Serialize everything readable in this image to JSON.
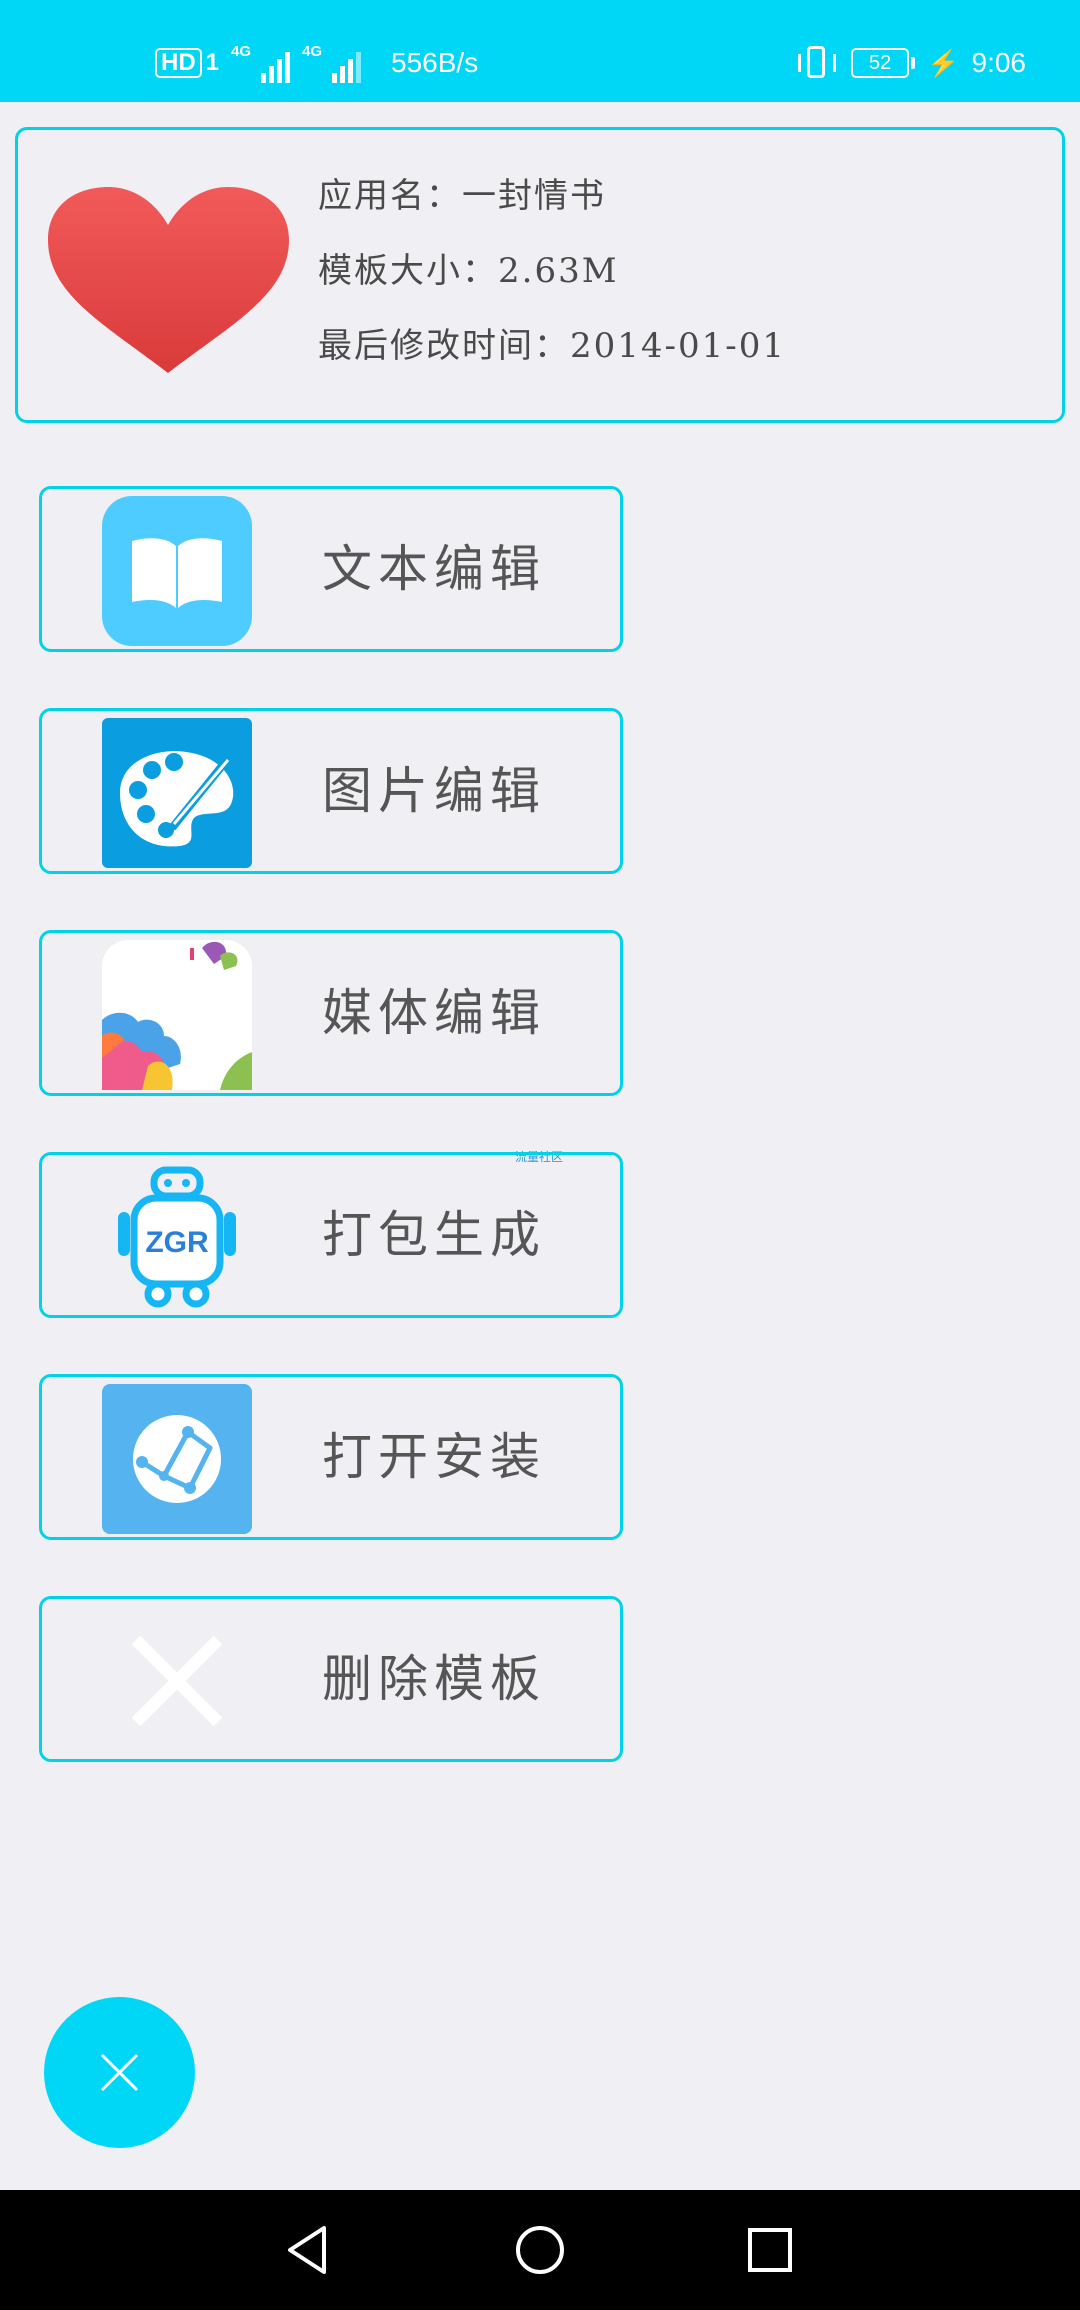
{
  "status_bar": {
    "hd_label": "HD",
    "hd_sub": "1",
    "network_1": "4G",
    "network_2": "4G",
    "speed": "556B/s",
    "battery": "52",
    "time": "9:06"
  },
  "info": {
    "app_name": "应用名：一封情书",
    "template_size": "模板大小：2.63M",
    "last_modified": "最后修改时间：2014-01-01"
  },
  "actions": [
    {
      "label": "文本编辑",
      "icon": "book-icon"
    },
    {
      "label": "图片编辑",
      "icon": "palette-icon"
    },
    {
      "label": "媒体编辑",
      "icon": "media-icon"
    },
    {
      "label": "打包生成",
      "icon": "robot-icon"
    },
    {
      "label": "打开安装",
      "icon": "install-icon"
    },
    {
      "label": "删除模板",
      "icon": "delete-icon"
    }
  ],
  "watermark": "流量社区",
  "colors": {
    "accent": "#00d7f7",
    "border": "#00d2ea",
    "background": "#efeff4"
  }
}
